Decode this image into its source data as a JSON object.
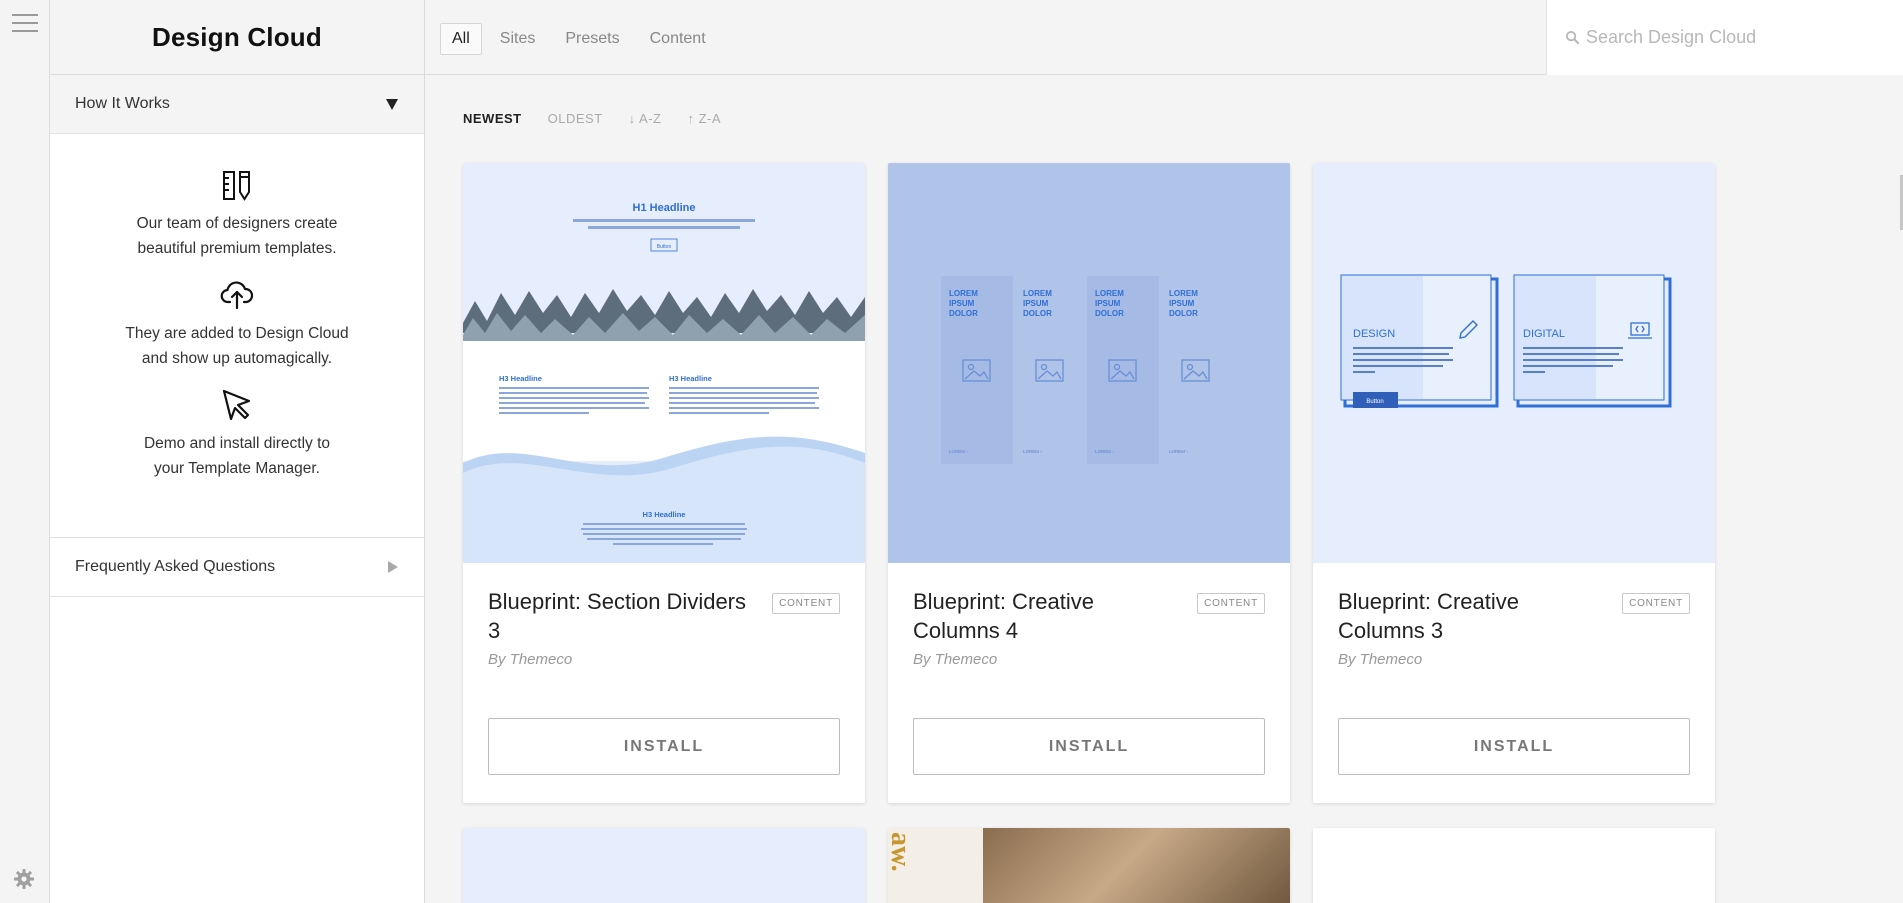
{
  "rail": {
    "menu_icon": "hamburger-icon",
    "settings_icon": "gear-icon"
  },
  "sidebar": {
    "title": "Design Cloud",
    "how_it_works": {
      "label": "How It Works",
      "steps": [
        {
          "icon": "ruler-pencil-icon",
          "line1": "Our team of designers create",
          "line2": "beautiful premium templates."
        },
        {
          "icon": "cloud-upload-icon",
          "line1": "They are added to Design Cloud",
          "line2": "and show up automagically."
        },
        {
          "icon": "cursor-arrow-icon",
          "line1": "Demo and install directly to",
          "line2": "your Template Manager."
        }
      ]
    },
    "faq": {
      "label": "Frequently Asked Questions"
    }
  },
  "topbar": {
    "tabs": [
      "All",
      "Sites",
      "Presets",
      "Content"
    ],
    "active_tab": "All",
    "search_placeholder": "Search Design Cloud"
  },
  "sort": {
    "options": [
      "NEWEST",
      "OLDEST",
      "↓ A-Z",
      "↑ Z-A"
    ],
    "active": "NEWEST"
  },
  "cards": [
    {
      "title": "Blueprint: Section Dividers 3",
      "badge": "CONTENT",
      "author": "By Themeco",
      "install_label": "INSTALL",
      "thumb": {
        "h1": "H1 Headline",
        "h1_sub": "Lorem ipsum dolor sit amet, consectetur adipiscing elit, sed do eiusmod tempor incididunt ut labore et dolore magna aliqua.",
        "button": "Button",
        "h3_left": "H3 Headline",
        "h3_right": "H3 Headline",
        "h3_bottom": "H3 Headline"
      }
    },
    {
      "title": "Blueprint: Creative Columns 4",
      "badge": "CONTENT",
      "author": "By Themeco",
      "install_label": "INSTALL",
      "thumb": {
        "col_line1": "LOREM",
        "col_line2": "IPSUM",
        "col_line3": "DOLOR",
        "col_link": "LOREM ›"
      }
    },
    {
      "title": "Blueprint: Creative Columns 3",
      "badge": "CONTENT",
      "author": "By Themeco",
      "install_label": "INSTALL",
      "thumb": {
        "box1_title": "DESIGN",
        "box2_title": "DIGITAL",
        "box_text": "Lorem ipsum dolor sit amet, consectetur adipiscing elit, sed do eiusmod tempor incididunt ut labore et dolore magna aliqua.",
        "button": "Button"
      }
    }
  ],
  "partial_row": {
    "card2_text": "aw."
  },
  "colors": {
    "accent_blue": "#2f6fd6",
    "thumb1_bg": "#e6edfc",
    "thumb2_bg": "#b0c3e8",
    "thumb3_bg": "#e6edfc"
  }
}
